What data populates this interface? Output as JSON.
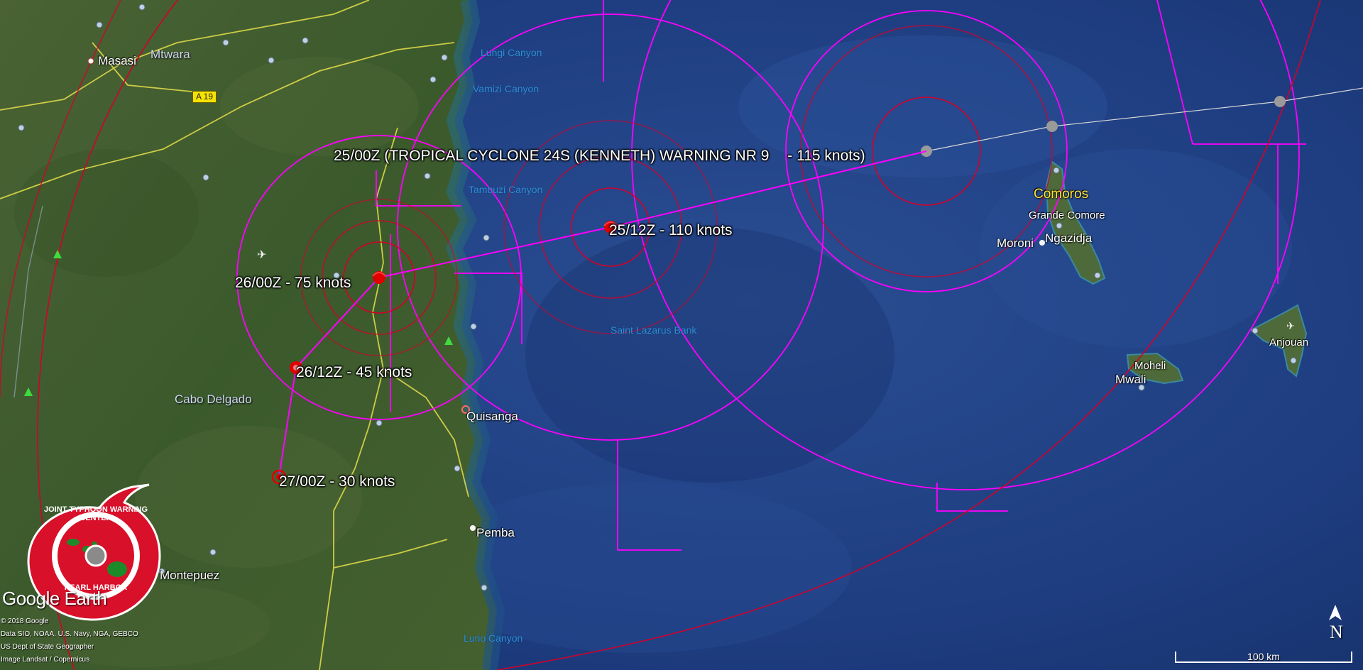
{
  "warning": {
    "title": "25/00Z (TROPICAL CYCLONE 24S (KENNETH) WARNING NR 9",
    "title_intensity": "- 115 knots)",
    "forecast_points": [
      {
        "label": "25/12Z - 110 knots"
      },
      {
        "label": "26/00Z - 75 knots"
      },
      {
        "label": "26/12Z - 45 knots"
      },
      {
        "label": "27/00Z - 30 knots"
      }
    ]
  },
  "places": {
    "masasi": "Masasi",
    "mtwara": "Mtwara",
    "cabo_delgado": "Cabo Delgado",
    "quisanga": "Quisanga",
    "pemba": "Pemba",
    "montepuez": "Montepuez",
    "comoros": "Comoros",
    "grande_comore": "Grande Comore",
    "moroni": "Moroni",
    "ngazidja": "Ngazidja",
    "moheli": "Moheli",
    "mwali": "Mwali",
    "anjouan": "Anjouan"
  },
  "water_features": {
    "lungi": "Lungi Canyon",
    "vamizi": "Vamizi Canyon",
    "tambuzi": "Tambuzi Canyon",
    "saint_lazarus": "Saint Lazarus Bank",
    "lurio": "Lurio Canyon"
  },
  "road_badge": "A 19",
  "logo": {
    "ring_text": "JOINT TYPHOON WARNING CENTER",
    "bottom_text": "PEARL HARBOR"
  },
  "branding": "Google Earth",
  "attribution": [
    "© 2018 Google",
    "Data SIO, NOAA, U.S. Navy, NGA, GEBCO",
    "US Dept of State Geographer",
    "Image Landsat / Copernicus"
  ],
  "scale_label": "100 km",
  "north_label": "N",
  "colors": {
    "land": "#3f5a2c",
    "ocean": "#1d3f82",
    "danger_area": "#ff00ff",
    "wind_radius": "#d4002a",
    "track": "#ff00ff",
    "past_track": "#d8d8d8",
    "roads": "#e6e04a",
    "label_highlight": "#ffe33a"
  },
  "icons": {
    "forecast_point": "cyclone-position-icon",
    "past_point": "past-position-icon",
    "city": "city-marker-icon",
    "airport": "airport-icon",
    "park": "park-icon",
    "north": "north-arrow-icon"
  }
}
